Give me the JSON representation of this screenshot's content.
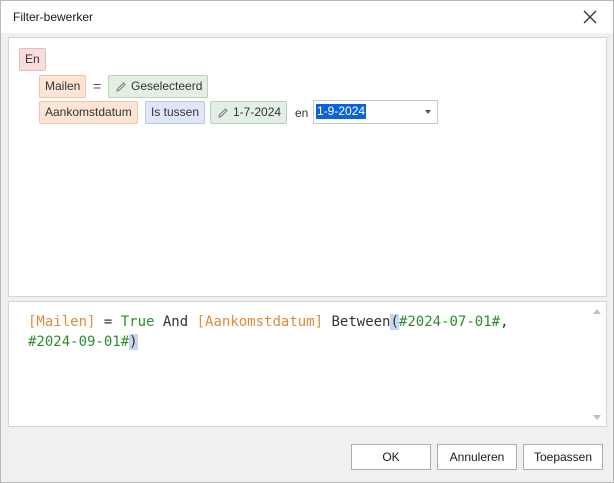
{
  "window": {
    "title": "Filter-bewerker"
  },
  "filter": {
    "group_label": "En",
    "row1": {
      "field": "Mailen",
      "operator": "=",
      "value": "Geselecteerd"
    },
    "row2": {
      "field": "Aankomstdatum",
      "operator": "Is tussen",
      "value_from": "1-7-2024",
      "and_label": "en",
      "value_to": "1-9-2024"
    }
  },
  "expression": {
    "t1": "[Mailen]",
    "t2": " = ",
    "t3": "True",
    "t4": " And ",
    "t5": "[Aankomstdatum]",
    "t6": " Between",
    "t7": "(",
    "t8": "#2024-07-01#",
    "t9": ",",
    "t10": "#2024-09-01#",
    "t11": ")"
  },
  "buttons": {
    "ok": "OK",
    "cancel": "Annuleren",
    "apply": "Toepassen"
  },
  "colors": {
    "field": "#e08a3c",
    "keyword": "#2e8b2e",
    "selection": "#0a64d8"
  }
}
